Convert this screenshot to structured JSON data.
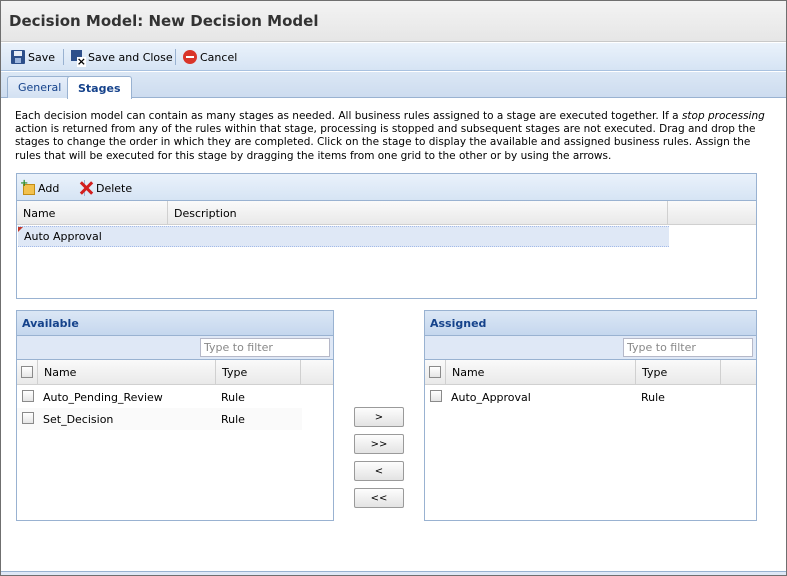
{
  "window": {
    "title": "Decision Model: New Decision Model"
  },
  "toolbar": {
    "save_label": "Save",
    "save_close_label": "Save and Close",
    "cancel_label": "Cancel"
  },
  "tabs": [
    {
      "label": "General",
      "active": false
    },
    {
      "label": "Stages",
      "active": true
    }
  ],
  "description": {
    "part1": "Each decision model can contain as many stages as needed. All business rules assigned to a stage are executed together. If a ",
    "emphasis": "stop processing",
    "part2": " action is returned from any of the rules within that stage, processing is stopped and subsequent stages are not executed. Drag and drop the stages to change the order in which they are completed. Click on the stage to display the available and assigned business rules. Assign the rules that will be executed for this stage by dragging the items from one grid to the other or by using the arrows."
  },
  "stages": {
    "add_label": "Add",
    "delete_label": "Delete",
    "columns": {
      "name": "Name",
      "description": "Description"
    },
    "rows": [
      {
        "name": "Auto Approval",
        "description": ""
      }
    ]
  },
  "available": {
    "title": "Available",
    "filter_placeholder": "Type to filter",
    "columns": {
      "name": "Name",
      "type": "Type"
    },
    "rows": [
      {
        "name": "Auto_Pending_Review",
        "type": "Rule"
      },
      {
        "name": "Set_Decision",
        "type": "Rule"
      }
    ]
  },
  "assigned": {
    "title": "Assigned",
    "filter_placeholder": "Type to filter",
    "columns": {
      "name": "Name",
      "type": "Type"
    },
    "rows": [
      {
        "name": "Auto_Approval",
        "type": "Rule"
      }
    ]
  },
  "transfer": {
    "move_right": ">",
    "move_all_right": ">>",
    "move_left": "<",
    "move_all_left": "<<"
  },
  "colors": {
    "accent": "#15428b",
    "header_bg": "#dbe7f5",
    "selected_row": "#dfe8f6"
  }
}
